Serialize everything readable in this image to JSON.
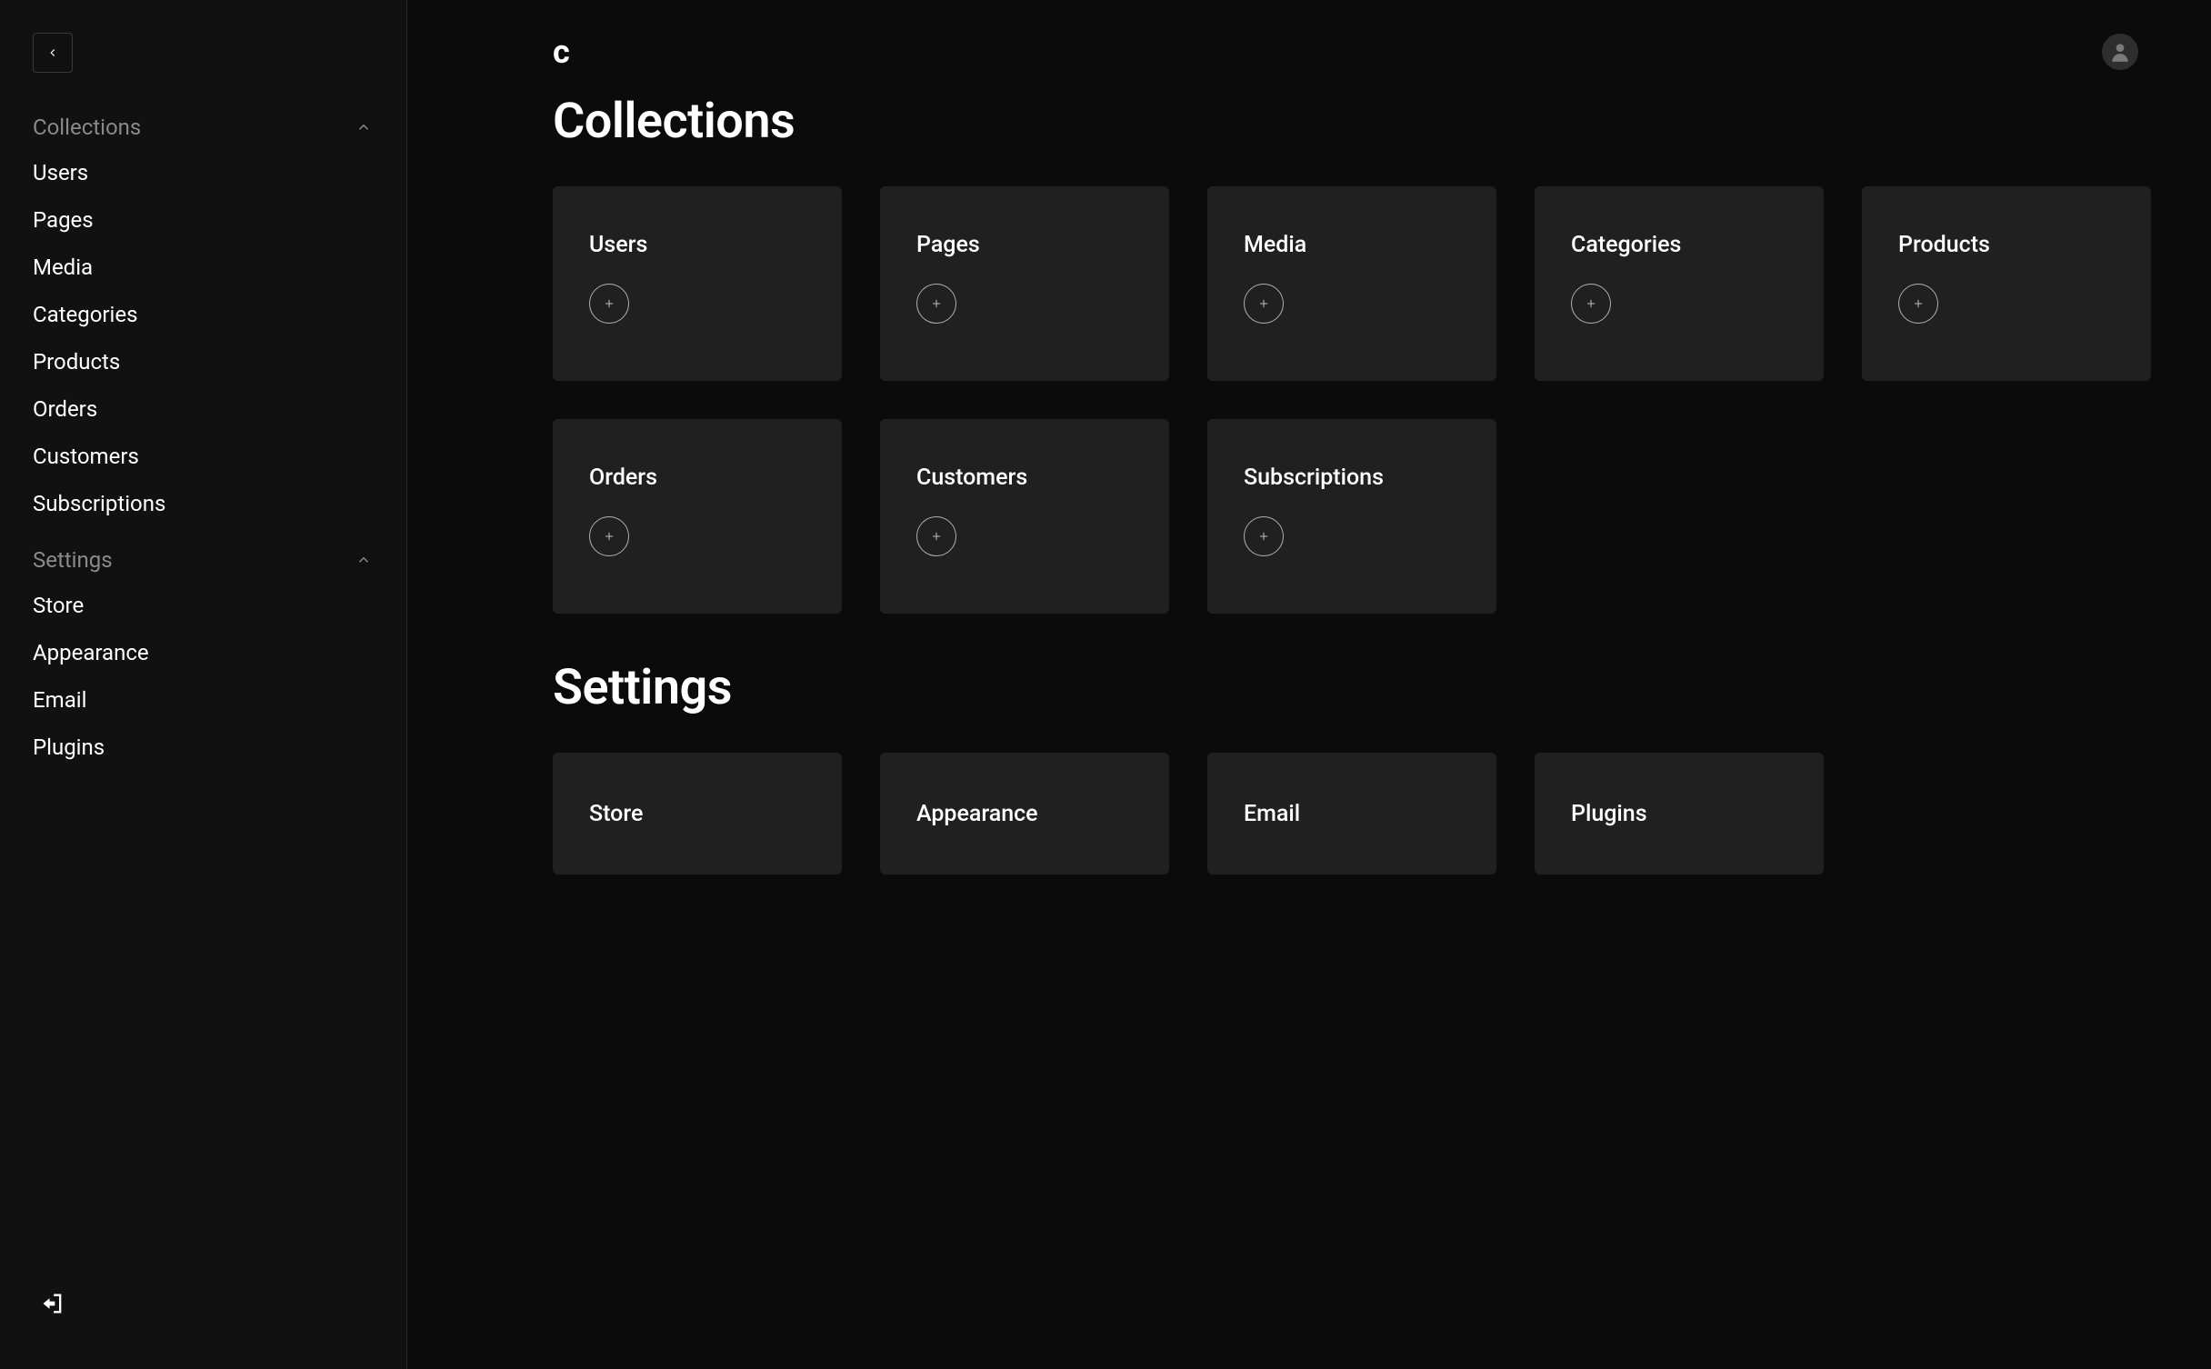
{
  "sidebar": {
    "sections": [
      {
        "label": "Collections",
        "items": [
          {
            "label": "Users"
          },
          {
            "label": "Pages"
          },
          {
            "label": "Media"
          },
          {
            "label": "Categories"
          },
          {
            "label": "Products"
          },
          {
            "label": "Orders"
          },
          {
            "label": "Customers"
          },
          {
            "label": "Subscriptions"
          }
        ]
      },
      {
        "label": "Settings",
        "items": [
          {
            "label": "Store"
          },
          {
            "label": "Appearance"
          },
          {
            "label": "Email"
          },
          {
            "label": "Plugins"
          }
        ]
      }
    ]
  },
  "logo": "c",
  "main": {
    "sections": [
      {
        "title": "Collections",
        "has_add": true,
        "cards": [
          {
            "title": "Users"
          },
          {
            "title": "Pages"
          },
          {
            "title": "Media"
          },
          {
            "title": "Categories"
          },
          {
            "title": "Products"
          },
          {
            "title": "Orders"
          },
          {
            "title": "Customers"
          },
          {
            "title": "Subscriptions"
          }
        ]
      },
      {
        "title": "Settings",
        "has_add": false,
        "cards": [
          {
            "title": "Store"
          },
          {
            "title": "Appearance"
          },
          {
            "title": "Email"
          },
          {
            "title": "Plugins"
          }
        ]
      }
    ]
  }
}
